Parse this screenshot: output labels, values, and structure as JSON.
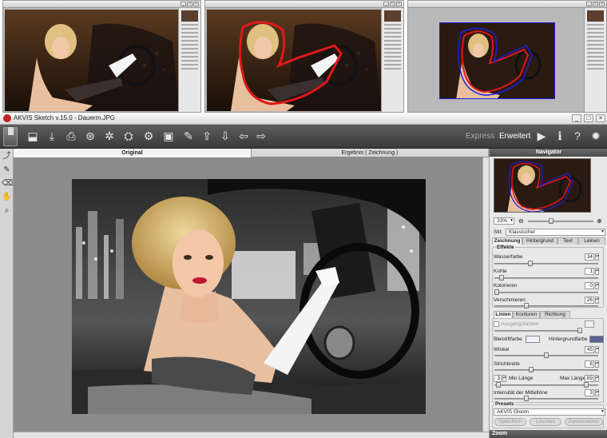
{
  "window": {
    "title": "AKVIS Sketch v.15.0 - Dauerm.JPG",
    "buttons": [
      "_",
      "□",
      "×"
    ]
  },
  "toolbar": {
    "modes": {
      "express": "Express",
      "advanced": "Erweitert"
    },
    "icons": [
      "open-icon",
      "save-icon",
      "print-icon",
      "share-icon",
      "batch-icon",
      "plugin-icon",
      "plugin-settings-icon",
      "canvas-icon",
      "paint-icon",
      "export-icon",
      "import-icon",
      "undo-icon",
      "redo-icon",
      "run-icon",
      "info-icon",
      "help-icon",
      "settings-icon"
    ]
  },
  "tabs": {
    "original": "Original",
    "result": "Ergebnis ( Zeichnung )"
  },
  "navigator": {
    "title": "Navigator",
    "zoom": "33%"
  },
  "panel": {
    "style_label": "Stil:",
    "style_value": "Klassischer",
    "tabs": [
      "Zeichnung",
      "Hintergrund",
      "Text",
      "Leinen"
    ],
    "effects_title": "Effekte",
    "effects": [
      {
        "label": "Wasserfarbe",
        "value": "34",
        "pos": 0.34
      },
      {
        "label": "Kohle",
        "value": "1",
        "pos": 0.05
      },
      {
        "label": "Kolorieren",
        "value": "0",
        "pos": 0.0
      },
      {
        "label": "Verschmieren",
        "value": "26",
        "pos": 0.3
      }
    ],
    "line_tabs": [
      "Linien",
      "Konturen",
      "Richtung"
    ],
    "source_colors": "Ausgangsfarben",
    "pencil_color": "Bleistiftfarbe",
    "background_color": "Hintergrundfarbe",
    "angle": {
      "label": "Winkel",
      "value": "45",
      "pos": 0.5
    },
    "stroke_width": {
      "label": "Strichbreite",
      "value": "8",
      "pos": 0.35
    },
    "min_length_label": "Min Länge",
    "min_length_value": "3",
    "max_length_label": "Max Länge",
    "max_length_value": "89",
    "midtones": {
      "label": "Intensität der Mitteltöne",
      "value": "3",
      "pos": 0.3
    },
    "presets_title": "Presets",
    "preset_value": "AKVIS Gloom",
    "buttons": [
      "Speichern",
      "Löschen",
      "Zurücksetzen"
    ],
    "zoom_title": "Zoom"
  },
  "colors": {
    "toolbar": "#444444",
    "accent_outline_red": "#e01818",
    "accent_outline_blue": "#2020d8",
    "pencil_swatch": "#f0f0ff",
    "background_swatch": "#5a6490"
  }
}
